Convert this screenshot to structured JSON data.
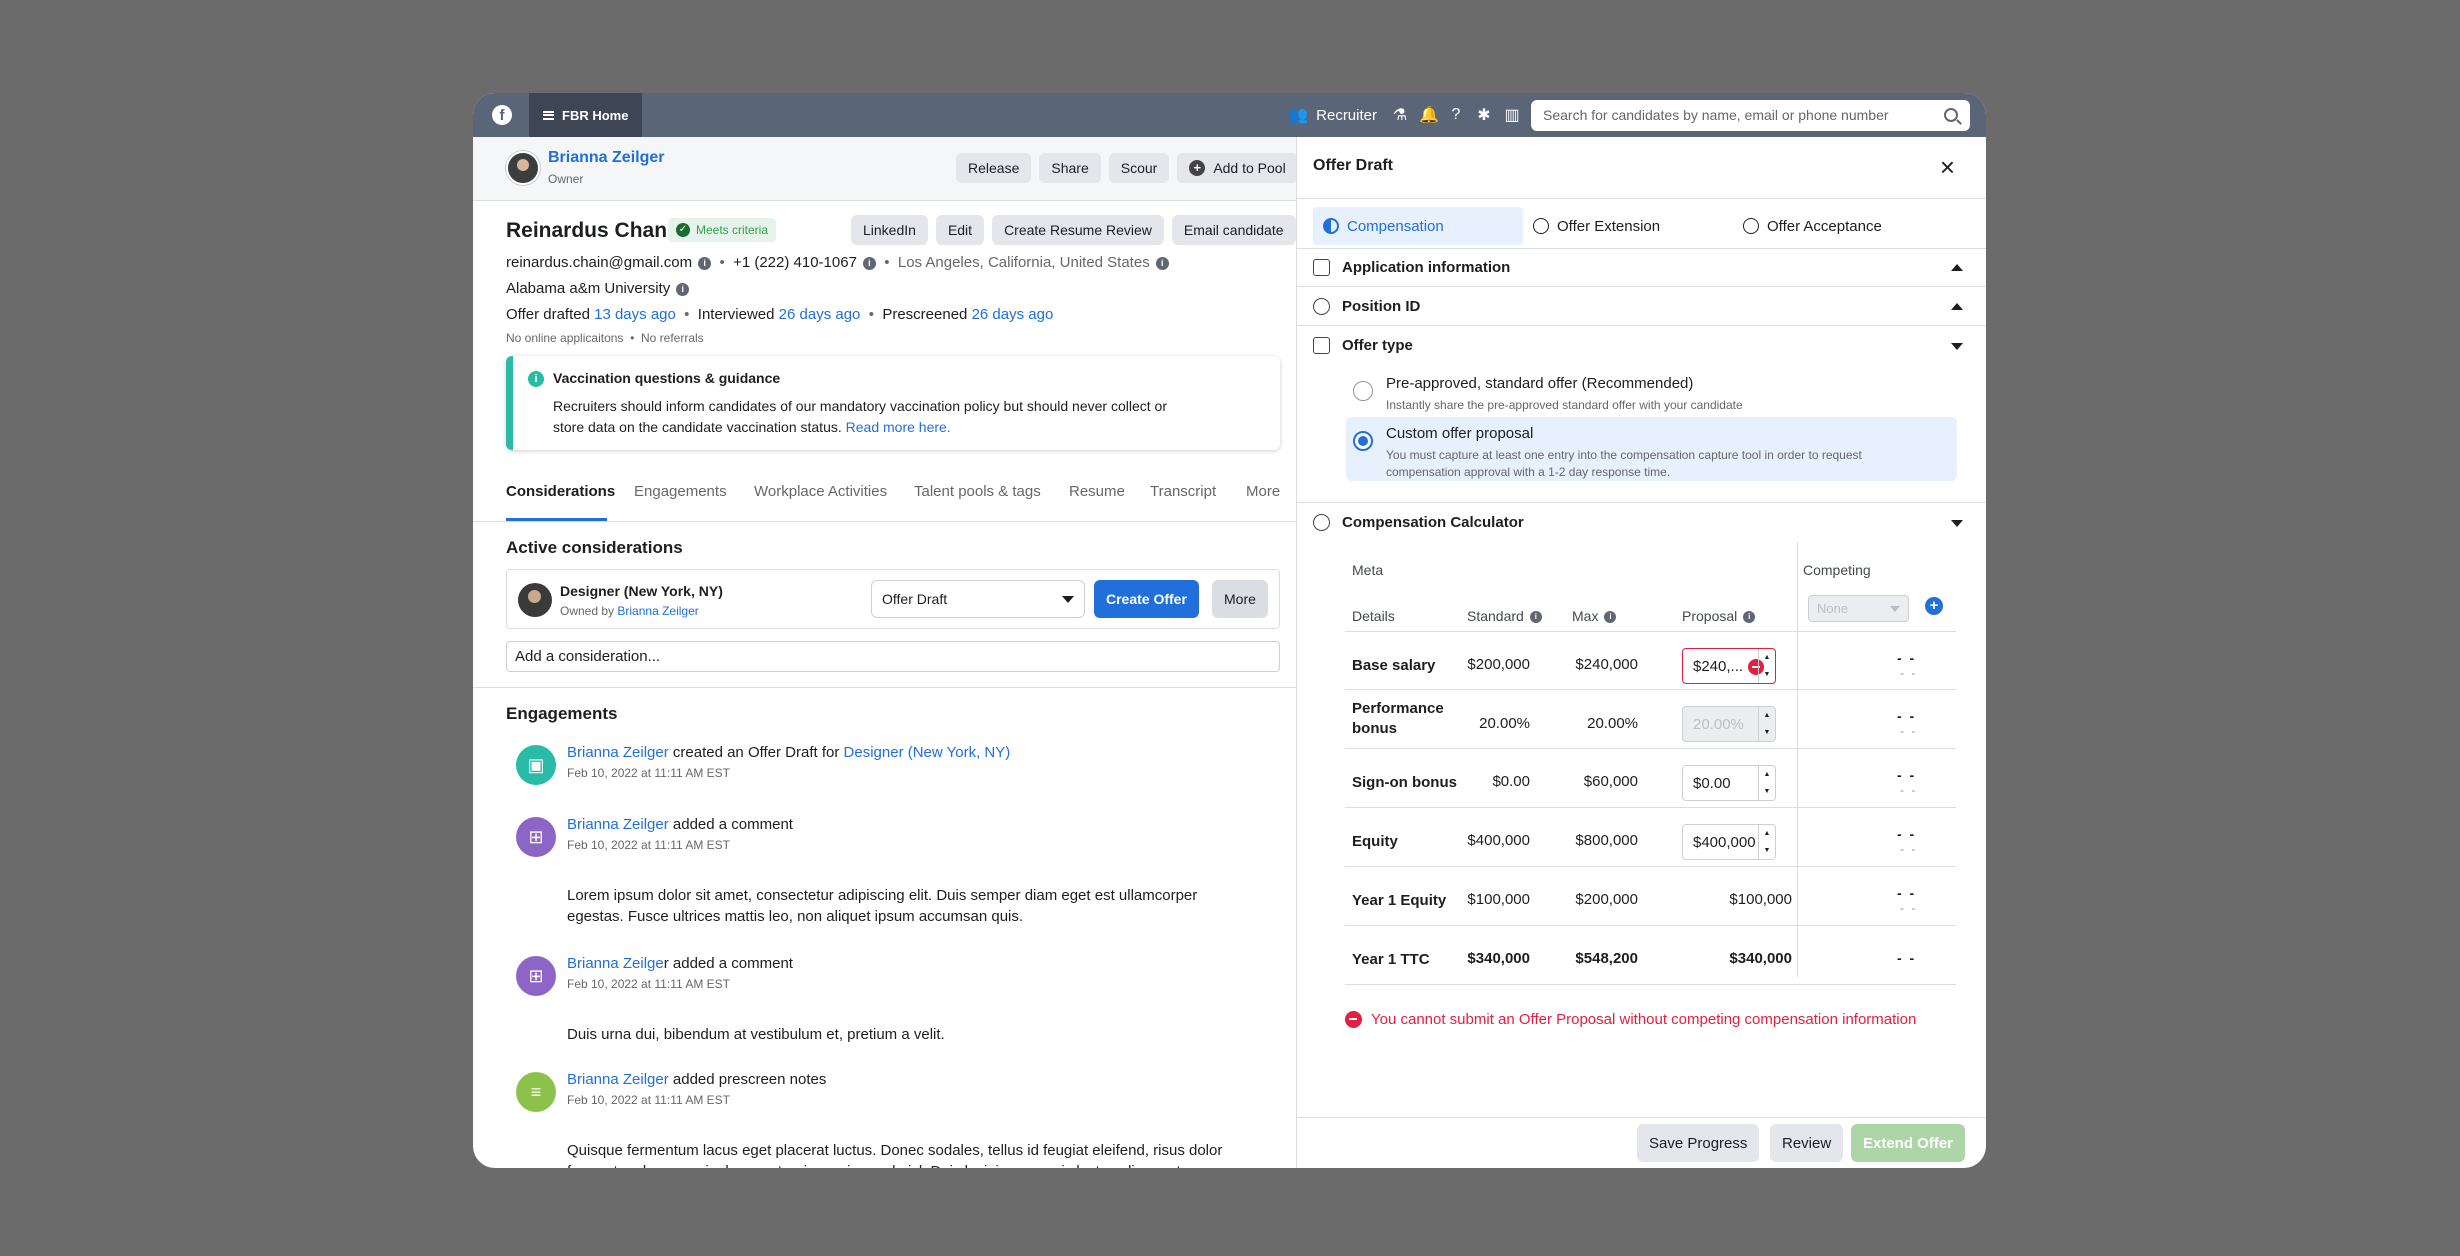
{
  "topbar": {
    "logo": "f",
    "home_tab": "FBR Home",
    "role": "Recruiter",
    "search_placeholder": "Search for candidates by name, email or phone number"
  },
  "owner": {
    "name": "Brianna Zeilger",
    "role": "Owner"
  },
  "owner_actions": [
    "Release",
    "Share",
    "Scour",
    "Add to Pool"
  ],
  "candidate": {
    "name": "Reinardus Chan",
    "criteria": "Meets criteria",
    "email": "reinardus.chain@gmail.com",
    "phone": "+1 (222) 410-1067",
    "location": "Los Angeles, California, United States",
    "school": "Alabama a&m University",
    "offer_label": "Offer drafted",
    "offer_ago": "13 days ago",
    "interviewed_label": "Interviewed",
    "interviewed_ago": "26 days ago",
    "prescreened_label": "Prescreened",
    "prescreened_ago": "26 days ago",
    "meta_a": "No online applicaitons",
    "meta_b": "No referrals"
  },
  "candidate_actions": [
    "LinkedIn",
    "Edit",
    "Create Resume Review",
    "Email candidate"
  ],
  "alert": {
    "title": "Vaccination questions & guidance",
    "body": "Recruiters should inform candidates of our mandatory vaccination policy but should never collect or store data on the candidate vaccination status.",
    "link": "Read more here."
  },
  "tabs": [
    "Considerations",
    "Engagements",
    "Workplace Activities",
    "Talent pools & tags",
    "Resume",
    "Transcript",
    "More"
  ],
  "considerations": {
    "heading": "Active considerations",
    "title": "Designer (New York, NY)",
    "owned_by": "Owned by",
    "owner": "Brianna Zeilger",
    "stage": "Offer Draft",
    "create_offer": "Create Offer",
    "more": "More",
    "add_placeholder": "Add a consideration..."
  },
  "engagements": {
    "heading": "Engagements",
    "items": [
      {
        "actor": "Brianna Zeilger",
        "action": " created an Offer Draft for ",
        "target": "Designer (New York, NY)",
        "time": "Feb 10, 2022 at 11:11 AM EST",
        "body": ""
      },
      {
        "actor": "Brianna Zeilger",
        "action": " added a comment",
        "target": "",
        "time": "Feb 10, 2022 at 11:11 AM EST",
        "body": "Lorem ipsum dolor sit amet, consectetur adipiscing elit. Duis semper diam eget est ullamcorper egestas. Fusce ultrices mattis leo, non aliquet ipsum accumsan quis."
      },
      {
        "actor": "Brianna Zeilge",
        "action": "r added a comment",
        "target": "",
        "time": "Feb 10, 2022 at 11:11 AM EST",
        "body": "Duis urna dui, bibendum at vestibulum et, pretium a velit."
      },
      {
        "actor": "Brianna Zeilger",
        "action": " added prescreen notes",
        "target": "",
        "time": "Feb 10, 2022 at 11:11 AM EST",
        "body": "Quisque fermentum lacus eget placerat luctus. Donec sodales, tellus id  feugiat eleifend, risus dolor fermentum lorem, quis rhoncus turpis, sapien sed nisl. Duis lacinia eros quis luctus aliquam tempor."
      }
    ]
  },
  "offer": {
    "title": "Offer Draft",
    "steps": [
      "Compensation",
      "Offer Extension",
      "Offer Acceptance"
    ],
    "sections": {
      "application": "Application information",
      "position": "Position ID",
      "offer_type": "Offer type",
      "calculator": "Compensation Calculator"
    },
    "options": [
      {
        "title": "Pre-approved, standard offer (Recommended)",
        "desc": "Instantly share the pre-approved standard offer with your candidate"
      },
      {
        "title": "Custom offer proposal",
        "desc": "You must capture at least one entry into the compensation capture tool in order to request compensation approval with a 1-2 day response time."
      }
    ],
    "table": {
      "meta": "Meta",
      "competing": "Competing",
      "details": "Details",
      "standard": "Standard",
      "max": "Max",
      "proposal": "Proposal",
      "competing_select": "None",
      "rows": [
        {
          "label": "Base salary",
          "standard": "$200,000",
          "max": "$240,000",
          "proposal": "$240,...",
          "comp": "- -",
          "comp2": "- -"
        },
        {
          "label": "Performance bonus",
          "standard": "20.00%",
          "max": "20.00%",
          "proposal": "20.00%",
          "comp": "- -",
          "comp2": "- -"
        },
        {
          "label": "Sign-on bonus",
          "standard": "$0.00",
          "max": "$60,000",
          "proposal": "$0.00",
          "comp": "- -",
          "comp2": "- -"
        },
        {
          "label": "Equity",
          "standard": "$400,000",
          "max": "$800,000",
          "proposal": "$400,000",
          "comp": "- -",
          "comp2": "- -"
        },
        {
          "label": "Year 1 Equity",
          "standard": "$100,000",
          "max": "$200,000",
          "proposal": "$100,000",
          "comp": "- -",
          "comp2": "- -"
        },
        {
          "label": "Year 1 TTC",
          "standard": "$340,000",
          "max": "$548,200",
          "proposal": "$340,000",
          "comp": "- -",
          "comp2": ""
        }
      ]
    },
    "error": "You cannot submit an Offer Proposal without competing compensation information",
    "footer": {
      "save": "Save Progress",
      "review": "Review",
      "extend": "Extend Offer"
    }
  },
  "colors": {
    "accent": "#216fdb",
    "error": "#e41e3f",
    "teal": "#2abba7",
    "topbar": "#5a6577"
  }
}
